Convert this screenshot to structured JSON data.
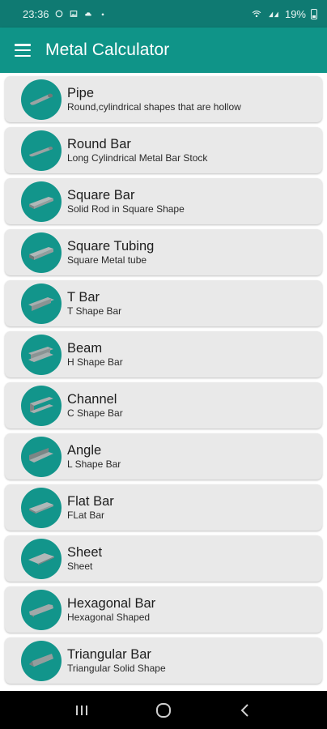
{
  "status_bar": {
    "time": "23:36",
    "battery": "19%"
  },
  "app_bar": {
    "title": "Metal Calculator"
  },
  "colors": {
    "primary": "#0f9488",
    "status": "#0f7a72",
    "card": "#e9e9e9"
  },
  "items": [
    {
      "title": "Pipe",
      "subtitle": "Round,cylindrical shapes that are hollow",
      "icon": "pipe-icon"
    },
    {
      "title": "Round Bar",
      "subtitle": "Long Cylindrical Metal Bar Stock",
      "icon": "round-bar-icon"
    },
    {
      "title": "Square Bar",
      "subtitle": "Solid Rod in Square Shape",
      "icon": "square-bar-icon"
    },
    {
      "title": "Square Tubing",
      "subtitle": "Square Metal tube",
      "icon": "square-tubing-icon"
    },
    {
      "title": "T Bar",
      "subtitle": "T Shape Bar",
      "icon": "t-bar-icon"
    },
    {
      "title": "Beam",
      "subtitle": "H Shape Bar",
      "icon": "beam-icon"
    },
    {
      "title": "Channel",
      "subtitle": "C Shape Bar",
      "icon": "channel-icon"
    },
    {
      "title": "Angle",
      "subtitle": "L Shape Bar",
      "icon": "angle-icon"
    },
    {
      "title": "Flat Bar",
      "subtitle": "FLat Bar",
      "icon": "flat-bar-icon"
    },
    {
      "title": "Sheet",
      "subtitle": "Sheet",
      "icon": "sheet-icon"
    },
    {
      "title": "Hexagonal Bar",
      "subtitle": "Hexagonal Shaped",
      "icon": "hexagonal-bar-icon"
    },
    {
      "title": "Triangular Bar",
      "subtitle": "Triangular Solid Shape",
      "icon": "triangular-bar-icon"
    }
  ],
  "nav_bar": {
    "buttons": [
      "recents-icon",
      "home-icon",
      "back-icon"
    ]
  }
}
